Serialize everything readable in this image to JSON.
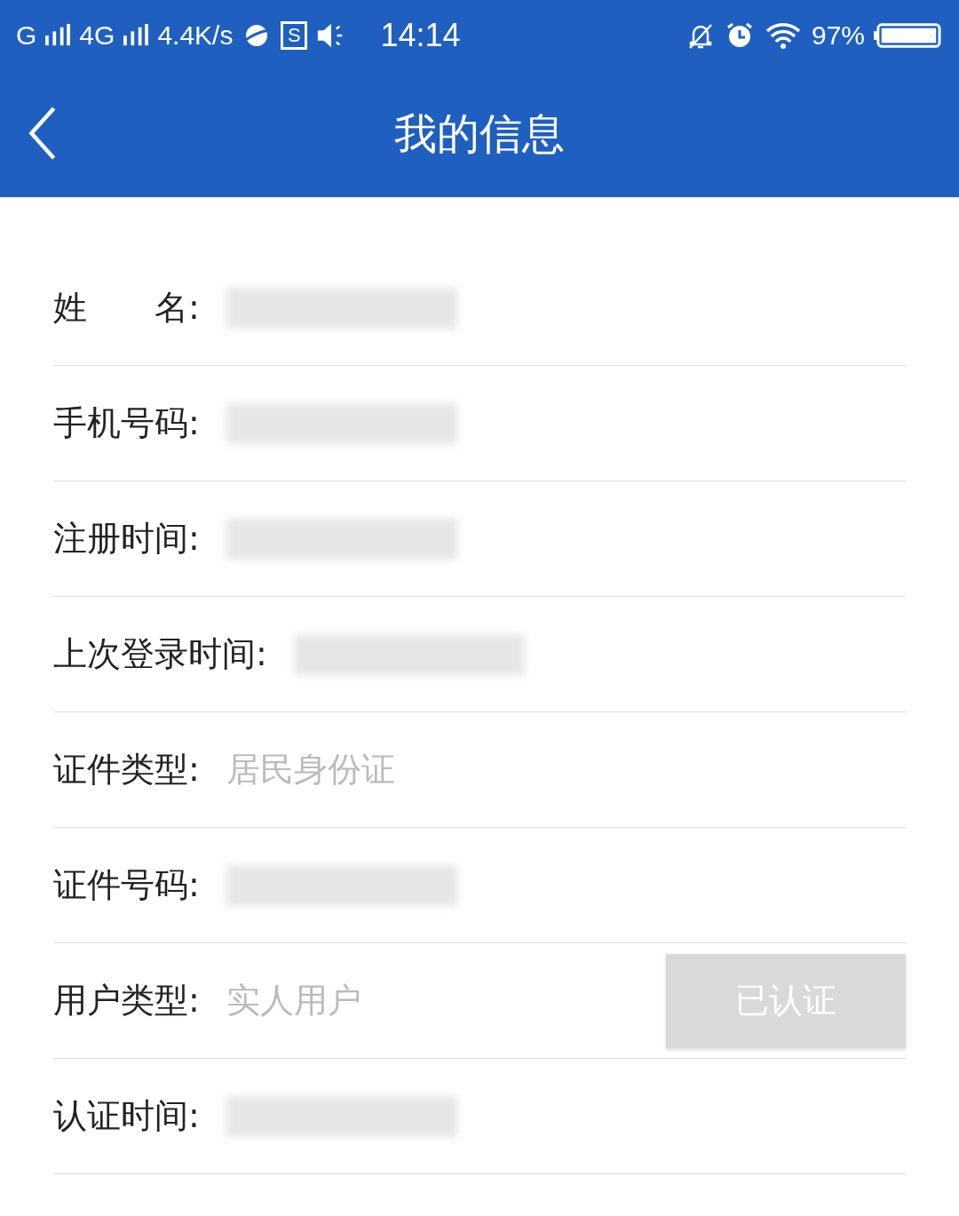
{
  "status_bar": {
    "network_1": "G",
    "network_2": "4G",
    "speed": "4.4K/s",
    "app_letter": "S",
    "time": "14:14",
    "battery": "97%"
  },
  "header": {
    "title": "我的信息"
  },
  "rows": [
    {
      "label": "姓　　名:",
      "kind": "redacted"
    },
    {
      "label": "手机号码:",
      "kind": "redacted"
    },
    {
      "label": "注册时间:",
      "kind": "redacted"
    },
    {
      "label": "上次登录时间:",
      "kind": "redacted"
    },
    {
      "label": "证件类型:",
      "kind": "text",
      "value": "居民身份证"
    },
    {
      "label": "证件号码:",
      "kind": "redacted"
    },
    {
      "label": "用户类型:",
      "kind": "text",
      "value": "实人用户",
      "button": {
        "label": "已认证",
        "disabled": true
      }
    },
    {
      "label": "认证时间:",
      "kind": "redacted"
    }
  ]
}
